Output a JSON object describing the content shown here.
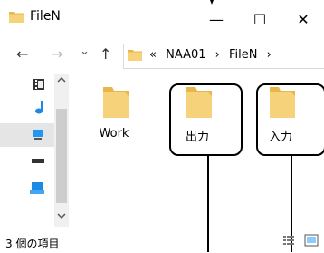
{
  "window": {
    "title": "FileN",
    "minimize_glyph": "—",
    "maximize_glyph": "☐",
    "close_glyph": "✕"
  },
  "nav": {
    "back_glyph": "←",
    "forward_glyph": "→",
    "recent_glyph": "⌄",
    "up_glyph": "↑"
  },
  "address": {
    "overflow": "«",
    "crumbs": [
      "NAA01",
      "FileN"
    ],
    "separator": "›"
  },
  "folders": [
    {
      "name": "Work"
    },
    {
      "name": "出力"
    },
    {
      "name": "入力"
    }
  ],
  "status": {
    "item_count": "3 個の項目"
  },
  "colors": {
    "folder": "#f6d37a",
    "folder_dark": "#e8b74a",
    "selection": "#e5e5e5"
  }
}
